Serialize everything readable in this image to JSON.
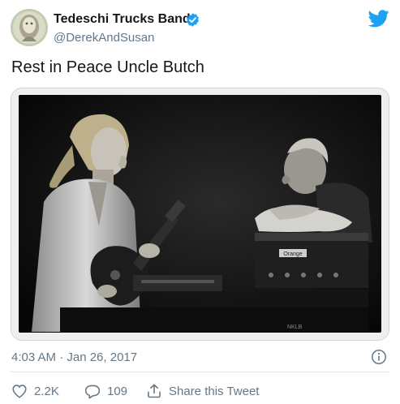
{
  "tweet": {
    "author_name": "Tedeschi Trucks Band",
    "author_handle": "@DerekAndSusan",
    "text": "Rest in Peace Uncle Butch",
    "timestamp": "4:03 AM · Jan 26, 2017",
    "likes": "2.2K",
    "replies": "109",
    "share_label": "Share this Tweet"
  },
  "media": {
    "amp_label": "Orange",
    "speaker_label": "NKLB"
  },
  "colors": {
    "brand": "#1da1f2",
    "text": "#14171a",
    "secondary": "#657786",
    "divider": "#e1e8ed"
  },
  "icons": {
    "verified": "verified-badge-icon",
    "bird": "twitter-bird-icon",
    "info": "info-icon",
    "like": "heart-icon",
    "reply": "reply-bubble-icon",
    "share": "share-icon"
  }
}
